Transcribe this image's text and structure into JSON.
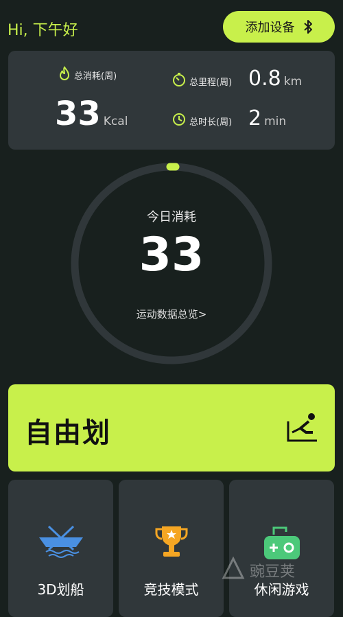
{
  "header": {
    "greeting": "Hi, 下午好",
    "add_device_label": "添加设备"
  },
  "stats": {
    "calories": {
      "label": "总消耗(周)",
      "value": "33",
      "unit": "Kcal"
    },
    "distance": {
      "label": "总里程(周)",
      "value": "0.8",
      "unit": "km"
    },
    "duration": {
      "label": "总时长(周)",
      "value": "2",
      "unit": "min"
    }
  },
  "today": {
    "title": "今日消耗",
    "value": "33",
    "link": "运动数据总览>"
  },
  "free_row": {
    "label": "自由划"
  },
  "modes": [
    {
      "label": "3D划船",
      "icon": "rowing-boat-icon"
    },
    {
      "label": "竞技模式",
      "icon": "trophy-icon"
    },
    {
      "label": "休闲游戏",
      "icon": "gamepad-icon"
    }
  ],
  "watermark": {
    "text": "豌豆荚"
  },
  "colors": {
    "accent": "#c8f04b",
    "background": "#18201e",
    "card": "#30373a",
    "trophy": "#f5a623",
    "gamepad": "#4cc97a"
  }
}
